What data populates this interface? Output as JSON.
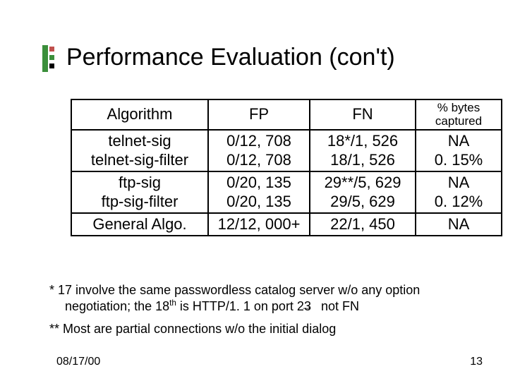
{
  "title": "Performance Evaluation (con't)",
  "chart_data": {
    "type": "table",
    "columns": [
      "Algorithm",
      "FP",
      "FN",
      "% bytes captured"
    ],
    "rows": [
      {
        "Algorithm": "telnet-sig",
        "FP": "0/12, 708",
        "FN": "18*/1, 526",
        "pct": "NA"
      },
      {
        "Algorithm": "telnet-sig-filter",
        "FP": "0/12, 708",
        "FN": "18/1, 526",
        "pct": "0. 15%"
      },
      {
        "Algorithm": "ftp-sig",
        "FP": "0/20, 135",
        "FN": "29**/5, 629",
        "pct": "NA"
      },
      {
        "Algorithm": "ftp-sig-filter",
        "FP": "0/20, 135",
        "FN": "29/5, 629",
        "pct": "0. 12%"
      },
      {
        "Algorithm": "General Algo.",
        "FP": "12/12, 000+",
        "FN": "22/1, 450",
        "pct": "NA"
      }
    ]
  },
  "table": {
    "headers": {
      "algo": "Algorithm",
      "fp": "FP",
      "fn": "FN",
      "pct": "% bytes captured"
    },
    "rows": [
      {
        "algo": "telnet-sig",
        "fp": "0/12, 708",
        "fn": "18*/1, 526",
        "pct": "NA"
      },
      {
        "algo": "telnet-sig-filter",
        "fp": "0/12, 708",
        "fn": "18/1, 526",
        "pct": "0. 15%"
      },
      {
        "algo": "ftp-sig",
        "fp": "0/20, 135",
        "fn": "29**/5, 629",
        "pct": "NA"
      },
      {
        "algo": "ftp-sig-filter",
        "fp": "0/20, 135",
        "fn": "29/5, 629",
        "pct": "0. 12%"
      },
      {
        "algo": "General Algo.",
        "fp": "12/12, 000+",
        "fn": "22/1, 450",
        "pct": "NA"
      }
    ]
  },
  "notes": {
    "n1_prefix": "*  17 involve the same passwordless catalog server w/o any option negotiation; the 18",
    "n1_sup": "th",
    "n1_mid": " is HTTP/1. 1 on port 23 ",
    "n1_arrow": "→",
    "n1_suffix": " not FN",
    "n2": "** Most are partial connections w/o the initial dialog"
  },
  "footer": {
    "date": "08/17/00",
    "page": "13"
  }
}
